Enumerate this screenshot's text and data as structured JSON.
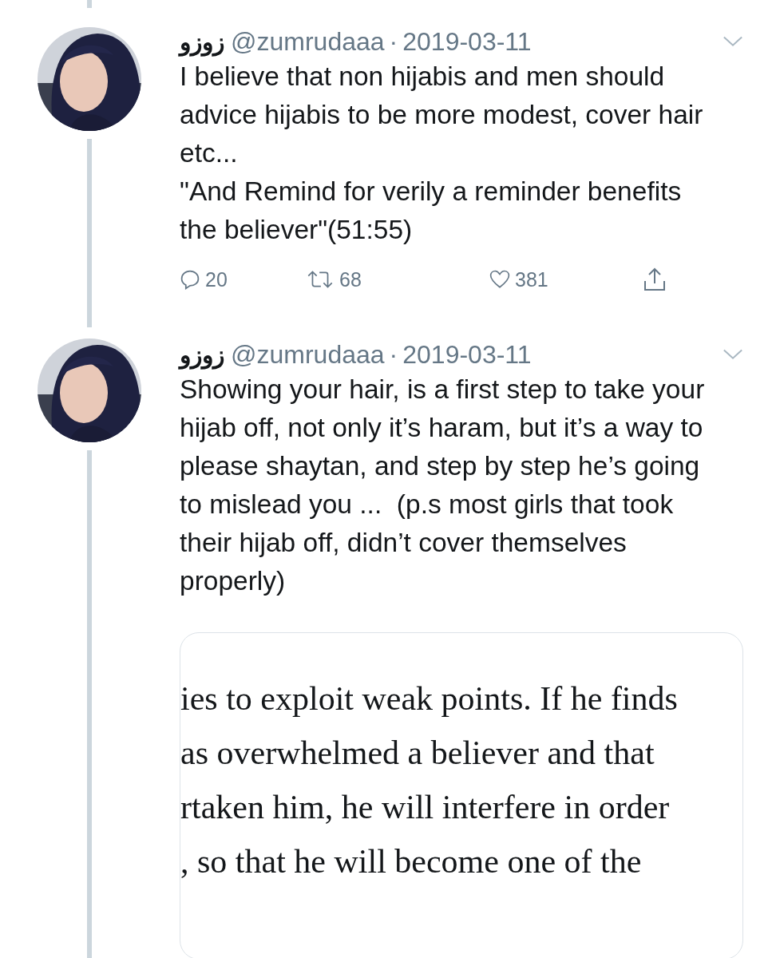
{
  "tweets": [
    {
      "display_name": "زوزو",
      "handle": "@zumrudaaa",
      "separator": "·",
      "date": "2019-03-11",
      "paragraphs": [
        "I believe that non hijabis and men should advice hijabis to be more modest, cover hair etc...",
        "\"And Remind for verily a reminder benefits the believer\"(51:55)"
      ],
      "actions": {
        "replies": "20",
        "retweets": "68",
        "likes": "381"
      }
    },
    {
      "display_name": "زوزو",
      "handle": "@zumrudaaa",
      "separator": "·",
      "date": "2019-03-11",
      "paragraphs": [
        "Showing your hair, is a first step to take your hijab off, not only it’s haram, but it’s a way to please shaytan, and step by step he’s going to mislead you ...  (p.s most girls that took their hijab off, didn’t cover themselves properly)"
      ],
      "attachment": {
        "kind": "document",
        "lines": [
          "ies to exploit weak points. If he finds",
          "as overwhelmed a believer and that",
          "rtaken him, he will interfere in order",
          ", so that he will become one of the"
        ]
      }
    }
  ]
}
